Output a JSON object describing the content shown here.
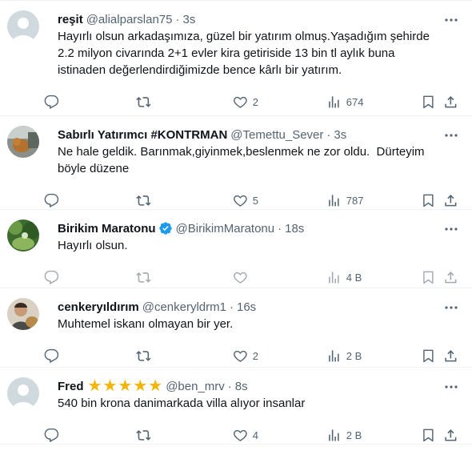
{
  "tweets": [
    {
      "name": "reşit",
      "handle": "@alialparslan75",
      "time": "3s",
      "text": "Hayırlı olsun arkadaşımıza, güzel bir yatırım olmuş.Yaşadığım şehirde 2.2 milyon civarında 2+1 evler kira getiriside 13 bin tl aylık buna istinaden değerlendirdiğimizde bence kârlı bir yatırım.",
      "likes": "2",
      "views": "674",
      "avatar": "generic-avatar"
    },
    {
      "name": "Sabırlı Yatırımcı #KONTRMAN",
      "handle": "@Temettu_Sever",
      "time": "3s",
      "text": "Ne hale geldik. Barınmak,giyinmek,beslenmek ne zor oldu.  Dürteyim böyle düzene",
      "likes": "5",
      "views": "787",
      "avatar": "cat-photo"
    },
    {
      "name": "Birikim Maratonu",
      "handle": "@BirikimMaratonu",
      "time": "18s",
      "text": "Hayırlı olsun.",
      "likes": "",
      "views": "4 B",
      "avatar": "nature-photo",
      "verified": true
    },
    {
      "name": "cenkeryıldırım",
      "handle": "@cenkeryldrm1",
      "time": "16s",
      "text": "Muhtemel iskanı olmayan bir yer.",
      "likes": "2",
      "views": "2 B",
      "avatar": "person-photo"
    },
    {
      "name": "Fred",
      "handle": "@ben_mrv",
      "time": "8s",
      "text": "540 bin krona danimarkada villa alıyor insanlar",
      "likes": "4",
      "views": "2 B",
      "avatar": "generic-avatar",
      "stars": 5
    }
  ],
  "separator": "·",
  "colors": {
    "text": "#0f1419",
    "muted": "#536471",
    "verified": "#1d9bf0",
    "star": "#f4b400",
    "border": "#eff3f4"
  }
}
